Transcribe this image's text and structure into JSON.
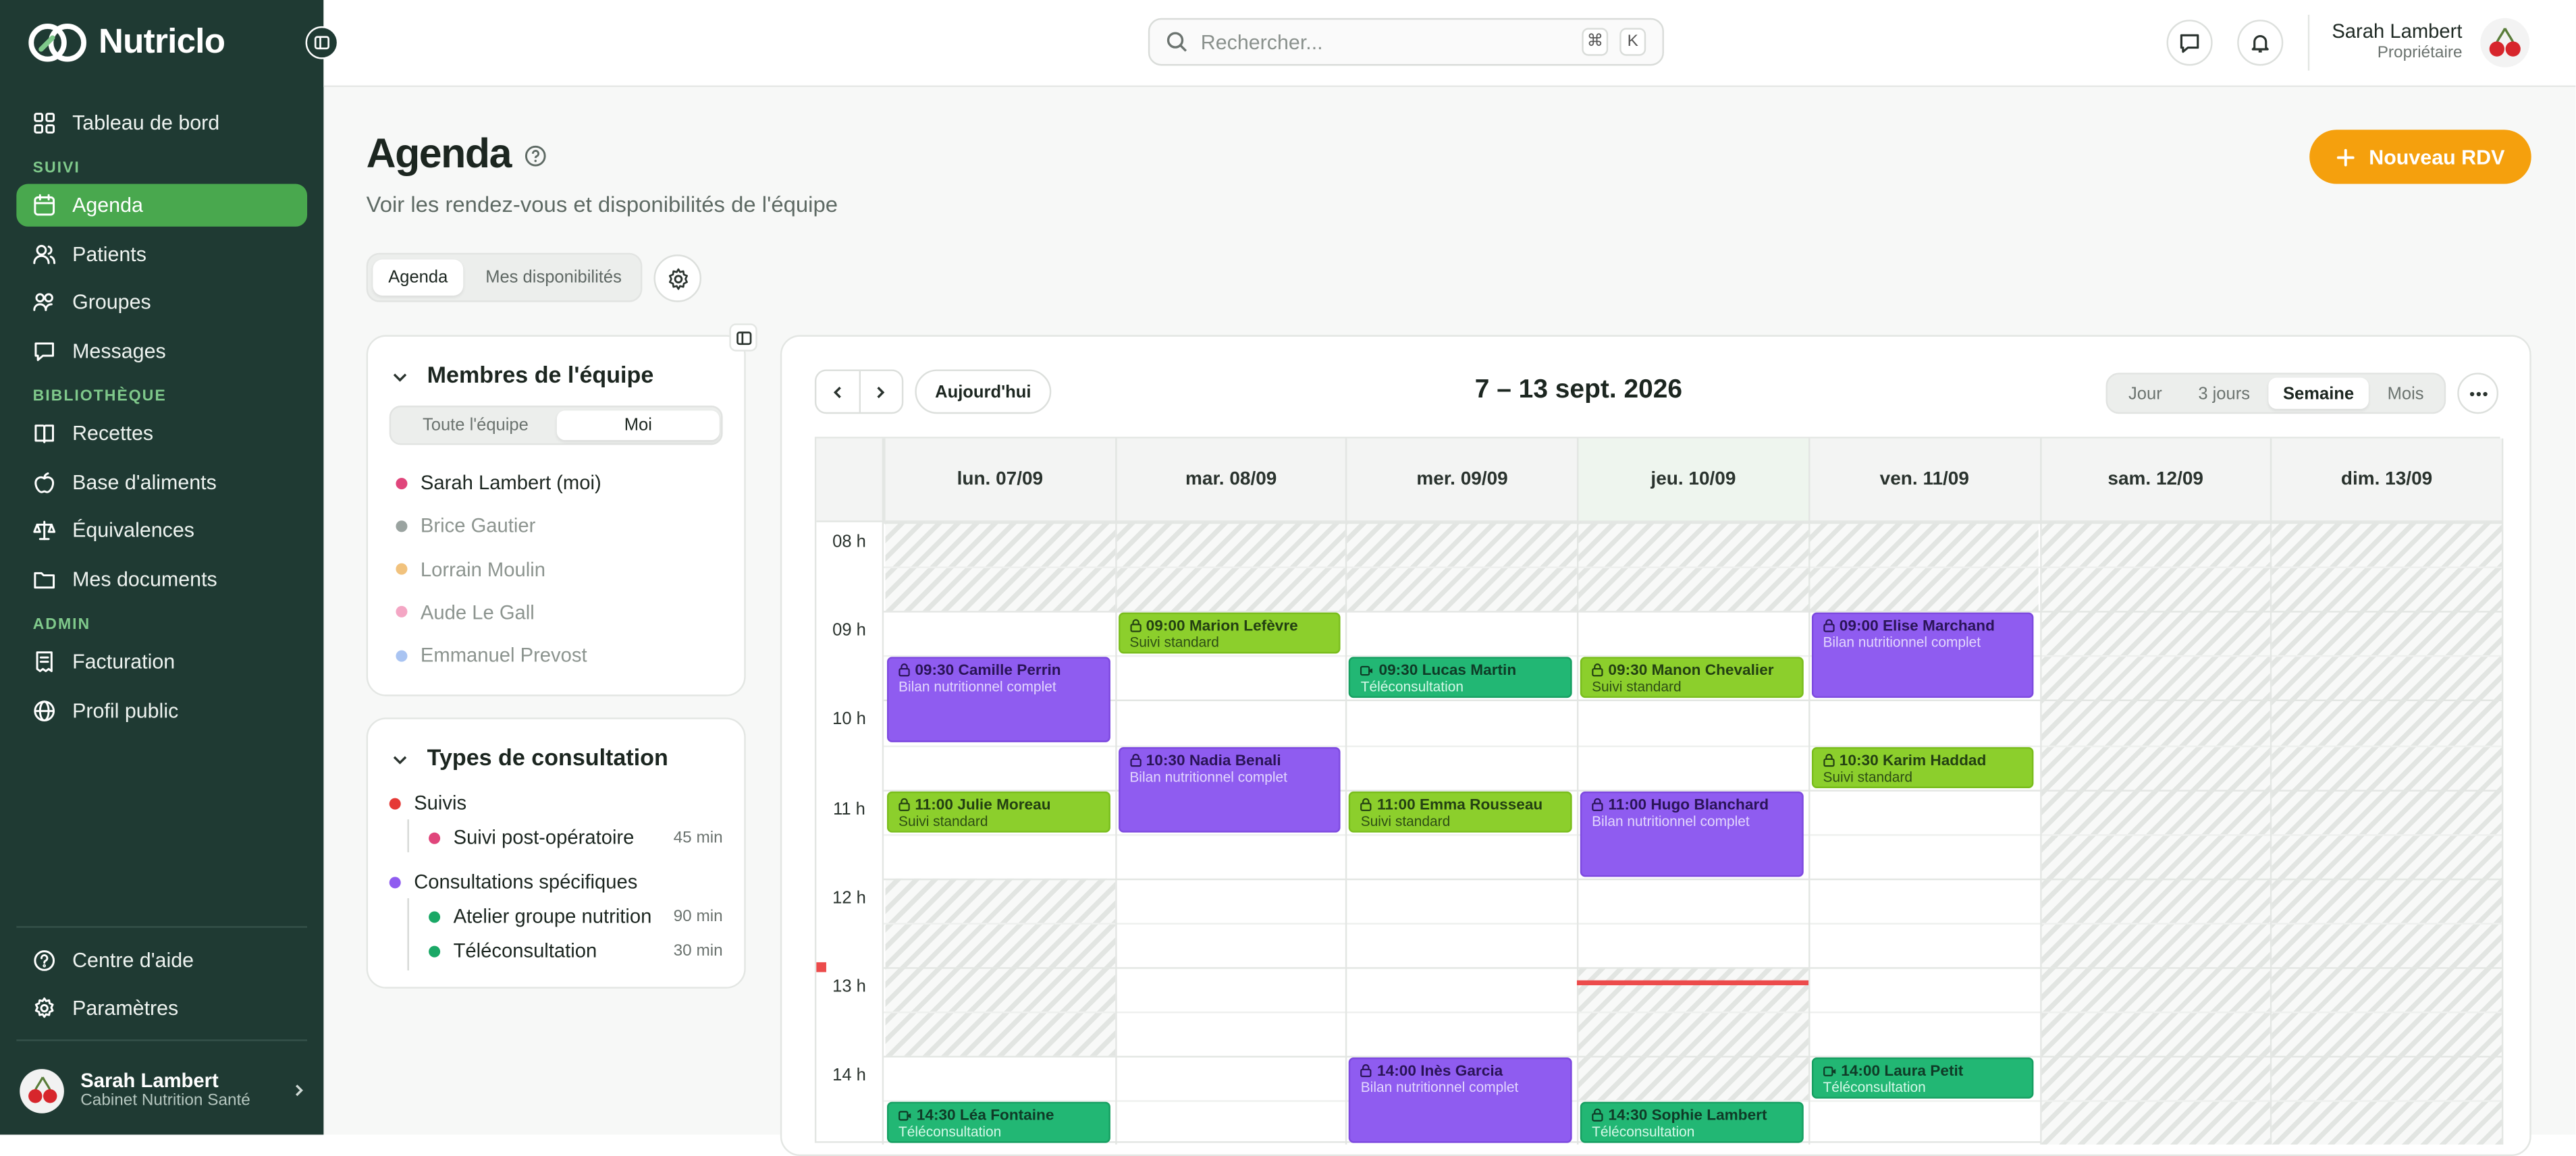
{
  "brand": {
    "name": "Nutriclo",
    "accent": "#49a84e",
    "sidebar_bg": "#1f3a33",
    "cta": "#f5a00d"
  },
  "sidebar": {
    "top": [
      {
        "label": "Tableau de bord",
        "icon": "dashboard-icon"
      }
    ],
    "sections": [
      {
        "title": "SUIVI",
        "items": [
          {
            "label": "Agenda",
            "icon": "calendar-icon",
            "active": true
          },
          {
            "label": "Patients",
            "icon": "users-icon"
          },
          {
            "label": "Groupes",
            "icon": "group-icon"
          },
          {
            "label": "Messages",
            "icon": "message-icon"
          }
        ]
      },
      {
        "title": "BIBLIOTHÈQUE",
        "items": [
          {
            "label": "Recettes",
            "icon": "book-icon"
          },
          {
            "label": "Base d'aliments",
            "icon": "apple-icon"
          },
          {
            "label": "Équivalences",
            "icon": "scale-icon"
          },
          {
            "label": "Mes documents",
            "icon": "folder-icon"
          }
        ]
      },
      {
        "title": "ADMIN",
        "items": [
          {
            "label": "Facturation",
            "icon": "receipt-icon"
          },
          {
            "label": "Profil public",
            "icon": "globe-icon"
          }
        ]
      }
    ],
    "bottom": [
      {
        "label": "Centre d'aide",
        "icon": "help-icon"
      },
      {
        "label": "Paramètres",
        "icon": "settings-icon"
      }
    ],
    "user": {
      "name": "Sarah Lambert",
      "subtitle": "Cabinet Nutrition Santé"
    }
  },
  "header": {
    "search_placeholder": "Rechercher...",
    "shortcut": [
      "⌘",
      "K"
    ],
    "user": {
      "name": "Sarah Lambert",
      "role": "Propriétaire"
    }
  },
  "page": {
    "title": "Agenda",
    "subtitle": "Voir les rendez-vous et disponibilités de l'équipe",
    "new_button": "Nouveau RDV",
    "tabs": [
      {
        "label": "Agenda",
        "active": true
      },
      {
        "label": "Mes disponibilités",
        "active": false
      }
    ]
  },
  "team": {
    "title": "Membres de l'équipe",
    "toggle": [
      {
        "label": "Toute l'équipe",
        "active": false
      },
      {
        "label": "Moi",
        "active": true
      }
    ],
    "members": [
      {
        "name": "Sarah Lambert (moi)",
        "color": "#e0457b",
        "active": true
      },
      {
        "name": "Brice Gautier",
        "color": "#9aa3a0",
        "active": false
      },
      {
        "name": "Lorrain Moulin",
        "color": "#f1c27d",
        "active": false
      },
      {
        "name": "Aude Le Gall",
        "color": "#f4a6c4",
        "active": false
      },
      {
        "name": "Emmanuel Prevost",
        "color": "#a9c4f2",
        "active": false
      }
    ]
  },
  "types": {
    "title": "Types de consultation",
    "groups": [
      {
        "label": "Suivis",
        "color": "#e53935",
        "items": [
          {
            "label": "Suivi post-opératoire",
            "duration": "45 min",
            "color": "#e0457b"
          }
        ]
      },
      {
        "label": "Consultations spécifiques",
        "color": "#8f5cf0",
        "items": [
          {
            "label": "Atelier groupe nutrition",
            "duration": "90 min",
            "color": "#1aa866"
          },
          {
            "label": "Téléconsultation",
            "duration": "30 min",
            "color": "#1aa866"
          }
        ]
      }
    ]
  },
  "calendar": {
    "range": "7 – 13 sept. 2026",
    "today_button": "Aujourd'hui",
    "views": [
      {
        "label": "Jour",
        "active": false
      },
      {
        "label": "3 jours",
        "active": false
      },
      {
        "label": "Semaine",
        "active": true
      },
      {
        "label": "Mois",
        "active": false
      }
    ],
    "days": [
      {
        "label": "lun. 07/09",
        "today": false
      },
      {
        "label": "mar. 08/09",
        "today": false
      },
      {
        "label": "mer. 09/09",
        "today": false
      },
      {
        "label": "jeu. 10/09",
        "today": true
      },
      {
        "label": "ven. 11/09",
        "today": false
      },
      {
        "label": "sam. 12/09",
        "today": false
      },
      {
        "label": "dim. 13/09",
        "today": false
      }
    ],
    "hours": [
      "08 h",
      "09 h",
      "10 h",
      "11 h",
      "12 h",
      "13 h",
      "14 h"
    ],
    "now": "13:10",
    "unavailable": [
      {
        "day": 0,
        "start": "08:00",
        "end": "09:00"
      },
      {
        "day": 1,
        "start": "08:00",
        "end": "09:00"
      },
      {
        "day": 2,
        "start": "08:00",
        "end": "09:00"
      },
      {
        "day": 3,
        "start": "08:00",
        "end": "09:00"
      },
      {
        "day": 4,
        "start": "08:00",
        "end": "09:00"
      },
      {
        "day": 0,
        "start": "12:00",
        "end": "14:00"
      },
      {
        "day": 3,
        "start": "13:00",
        "end": "14:30"
      },
      {
        "day": 5,
        "start": "08:00",
        "end": "15:00"
      },
      {
        "day": 6,
        "start": "08:00",
        "end": "15:00"
      }
    ],
    "events": [
      {
        "day": 0,
        "start": "09:30",
        "end": "10:30",
        "title": "09:30 Camille Perrin",
        "type": "Bilan nutritionnel complet",
        "kind": "bilan",
        "icon": "lock-icon"
      },
      {
        "day": 0,
        "start": "11:00",
        "end": "11:30",
        "title": "11:00 Julie Moreau",
        "type": "Suivi standard",
        "kind": "suivi",
        "icon": "lock-icon"
      },
      {
        "day": 0,
        "start": "14:30",
        "end": "15:00",
        "title": "14:30 Léa Fontaine",
        "type": "Téléconsultation",
        "kind": "tele",
        "icon": "video-icon"
      },
      {
        "day": 1,
        "start": "09:00",
        "end": "09:30",
        "title": "09:00 Marion Lefèvre",
        "type": "Suivi standard",
        "kind": "suivi",
        "icon": "lock-icon"
      },
      {
        "day": 1,
        "start": "10:30",
        "end": "11:30",
        "title": "10:30 Nadia Benali",
        "type": "Bilan nutritionnel complet",
        "kind": "bilan",
        "icon": "lock-icon"
      },
      {
        "day": 2,
        "start": "09:30",
        "end": "10:00",
        "title": "09:30 Lucas Martin",
        "type": "Téléconsultation",
        "kind": "tele",
        "icon": "video-icon"
      },
      {
        "day": 2,
        "start": "11:00",
        "end": "11:30",
        "title": "11:00 Emma Rousseau",
        "type": "Suivi standard",
        "kind": "suivi",
        "icon": "lock-icon"
      },
      {
        "day": 2,
        "start": "14:00",
        "end": "15:00",
        "title": "14:00 Inès Garcia",
        "type": "Bilan nutritionnel complet",
        "kind": "bilan",
        "icon": "lock-icon"
      },
      {
        "day": 3,
        "start": "09:30",
        "end": "10:00",
        "title": "09:30 Manon Chevalier",
        "type": "Suivi standard",
        "kind": "suivi",
        "icon": "lock-icon"
      },
      {
        "day": 3,
        "start": "11:00",
        "end": "12:00",
        "title": "11:00 Hugo Blanchard",
        "type": "Bilan nutritionnel complet",
        "kind": "bilan",
        "icon": "lock-icon"
      },
      {
        "day": 3,
        "start": "14:30",
        "end": "15:00",
        "title": "14:30 Sophie Lambert",
        "type": "Téléconsultation",
        "kind": "tele",
        "icon": "lock-icon"
      },
      {
        "day": 4,
        "start": "09:00",
        "end": "10:00",
        "title": "09:00 Elise Marchand",
        "type": "Bilan nutritionnel complet",
        "kind": "bilan",
        "icon": "lock-icon"
      },
      {
        "day": 4,
        "start": "10:30",
        "end": "11:00",
        "title": "10:30 Karim Haddad",
        "type": "Suivi standard",
        "kind": "suivi",
        "icon": "lock-icon"
      },
      {
        "day": 4,
        "start": "14:00",
        "end": "14:30",
        "title": "14:00 Laura Petit",
        "type": "Téléconsultation",
        "kind": "tele",
        "icon": "video-icon"
      }
    ]
  }
}
